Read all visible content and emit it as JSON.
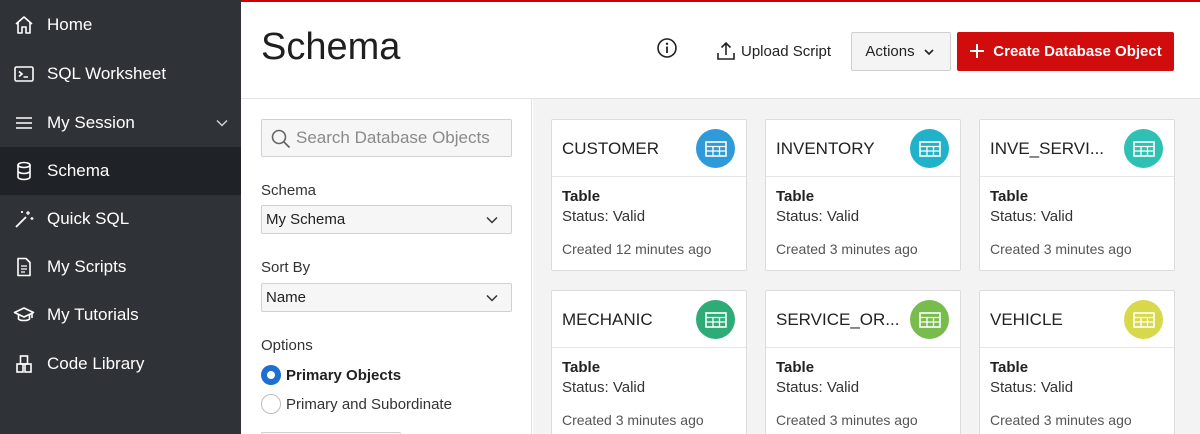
{
  "sidebar": {
    "items": [
      {
        "label": "Home",
        "icon": "home-icon"
      },
      {
        "label": "SQL Worksheet",
        "icon": "terminal-icon"
      },
      {
        "label": "My Session",
        "icon": "list-icon"
      },
      {
        "label": "Schema",
        "icon": "database-icon"
      },
      {
        "label": "Quick SQL",
        "icon": "magic-wand-icon"
      },
      {
        "label": "My Scripts",
        "icon": "document-icon"
      },
      {
        "label": "My Tutorials",
        "icon": "graduation-cap-icon"
      },
      {
        "label": "Code Library",
        "icon": "library-icon"
      }
    ],
    "active": "Schema"
  },
  "header": {
    "title": "Schema",
    "upload_label": "Upload Script",
    "actions_label": "Actions",
    "create_label": "Create Database Object"
  },
  "filters": {
    "search_placeholder": "Search Database Objects",
    "schema_label": "Schema",
    "schema_value": "My Schema",
    "sort_label": "Sort By",
    "sort_value": "Name",
    "options_label": "Options",
    "option_primary": "Primary Objects",
    "option_both": "Primary and Subordinate",
    "selected_option": "Primary Objects"
  },
  "cards": [
    {
      "name": "CUSTOMER",
      "display_name": "CUSTOMER",
      "type": "Table",
      "status": "Status: Valid",
      "created": "Created 12 minutes ago",
      "color": "#2f9ad8"
    },
    {
      "name": "INVENTORY",
      "display_name": "INVENTORY",
      "type": "Table",
      "status": "Status: Valid",
      "created": "Created 3 minutes ago",
      "color": "#1fb2c9"
    },
    {
      "name": "INVE_SERVI...",
      "display_name": "INVE_SERVI...",
      "type": "Table",
      "status": "Status: Valid",
      "created": "Created 3 minutes ago",
      "color": "#2ec0b3"
    },
    {
      "name": "MECHANIC",
      "display_name": "MECHANIC",
      "type": "Table",
      "status": "Status: Valid",
      "created": "Created 3 minutes ago",
      "color": "#2eac78"
    },
    {
      "name": "SERVICE_OR...",
      "display_name": "SERVICE_OR...",
      "type": "Table",
      "status": "Status: Valid",
      "created": "Created 3 minutes ago",
      "color": "#79bc4e"
    },
    {
      "name": "VEHICLE",
      "display_name": "VEHICLE",
      "type": "Table",
      "status": "Status: Valid",
      "created": "Created 3 minutes ago",
      "color": "#d7d94a"
    }
  ],
  "colors": {
    "sidebar_bg": "#2f3337",
    "sidebar_active": "#1f2226",
    "accent_red": "#d10c0c",
    "radio_blue": "#1d6fd1"
  }
}
